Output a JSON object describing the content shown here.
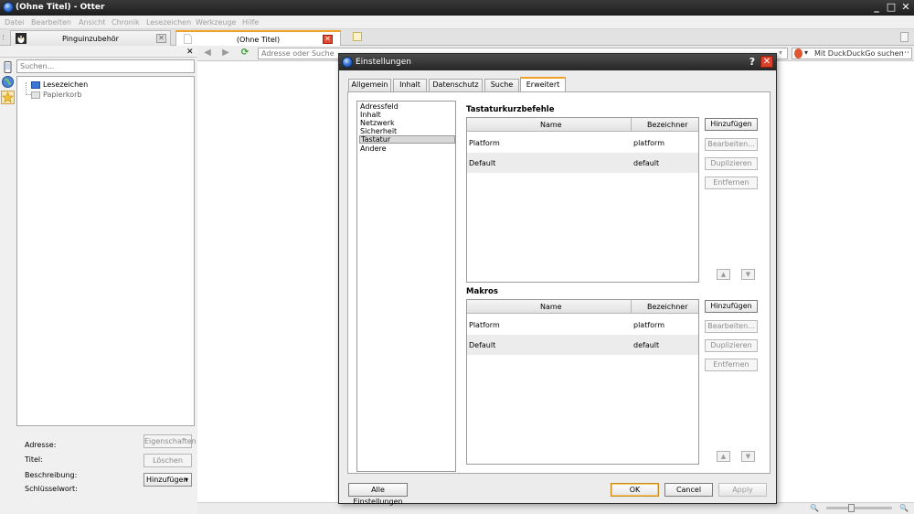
{
  "window": {
    "title": "(Ohne Titel) - Otter",
    "minimize": "_",
    "maximize": "□",
    "close": "✕"
  },
  "menu": [
    "Datei",
    "Bearbeiten",
    "Ansicht",
    "Chronik",
    "Lesezeichen",
    "Werkzeuge",
    "Hilfe"
  ],
  "tabs": [
    {
      "label": "Pinguinzubehör"
    },
    {
      "label": "(Ohne Titel)"
    }
  ],
  "sidebar": {
    "close": "✕",
    "search_placeholder": "Suchen...",
    "tree": [
      "Lesezeichen",
      "Papierkorb"
    ],
    "properties": {
      "address_label": "Adresse:",
      "title_label": "Titel:",
      "description_label": "Beschreibung:",
      "keyword_label": "Schlüsselwort:",
      "properties_button": "Eigenschaften",
      "delete_button": "Löschen",
      "add_button": "Hinzufügen"
    }
  },
  "navigation": {
    "address_placeholder": "Adresse oder Suche",
    "search_engine": "Mit DuckDuckGo suchen"
  },
  "dialog": {
    "title": "Einstellungen",
    "help": "?",
    "close": "✕",
    "tabs": [
      "Allgemein",
      "Inhalt",
      "Datenschutz",
      "Suche",
      "Erweitert"
    ],
    "active_tab": "Erweitert",
    "categories": [
      "Adressfeld",
      "Inhalt",
      "Netzwerk",
      "Sicherheit",
      "Tastatur",
      "Andere"
    ],
    "selected_category": "Tastatur",
    "shortcuts": {
      "title": "Tastaturkurzbefehle",
      "columns": [
        "Name",
        "Bezeichner"
      ],
      "rows": [
        {
          "name": "Platform",
          "id": "platform"
        },
        {
          "name": "Default",
          "id": "default"
        }
      ]
    },
    "macros": {
      "title": "Makros",
      "columns": [
        "Name",
        "Bezeichner"
      ],
      "rows": [
        {
          "name": "Platform",
          "id": "platform"
        },
        {
          "name": "Default",
          "id": "default"
        }
      ]
    },
    "side_buttons": [
      "Hinzufügen",
      "Bearbeiten...",
      "Duplizieren",
      "Entfernen"
    ],
    "footer": {
      "all_settings": "Alle Einstellungen",
      "ok": "OK",
      "cancel": "Cancel",
      "apply": "Apply"
    }
  },
  "colors": {
    "accent": "#f1a12a",
    "titlebar": "#262626",
    "close_red": "#d9412a"
  }
}
